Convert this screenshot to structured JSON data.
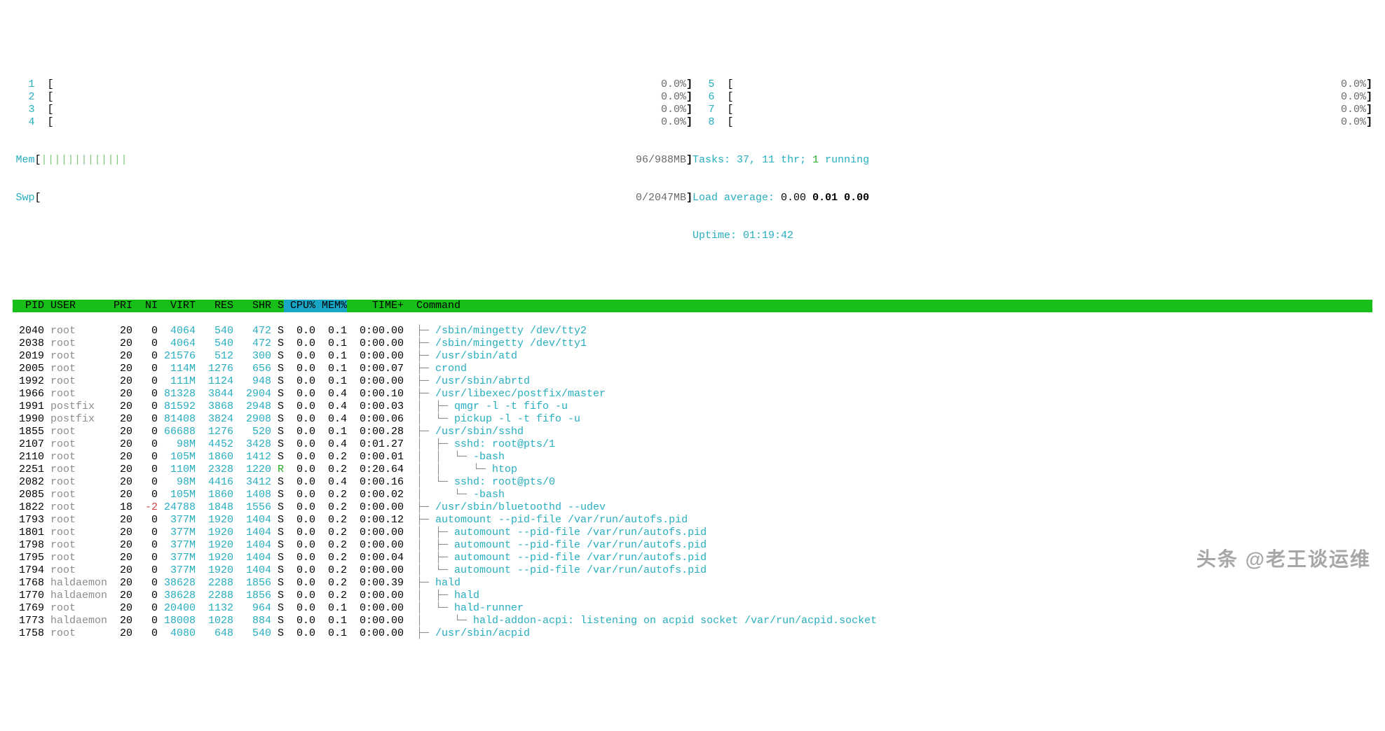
{
  "cpu_meters_left": [
    {
      "label": "1",
      "value": "0.0%"
    },
    {
      "label": "2",
      "value": "0.0%"
    },
    {
      "label": "3",
      "value": "0.0%"
    },
    {
      "label": "4",
      "value": "0.0%"
    }
  ],
  "cpu_meters_right": [
    {
      "label": "5",
      "value": "0.0%"
    },
    {
      "label": "6",
      "value": "0.0%"
    },
    {
      "label": "7",
      "value": "0.0%"
    },
    {
      "label": "8",
      "value": "0.0%"
    }
  ],
  "mem_meter": {
    "label": "Mem",
    "fill": "|||||||||||||",
    "value": "96/988MB"
  },
  "swp_meter": {
    "label": "Swp",
    "fill": "",
    "value": "0/2047MB"
  },
  "tasks": {
    "label": "Tasks:",
    "total": "37",
    "thr_label": "11 thr;",
    "running": "1",
    "running_label": "running"
  },
  "load": {
    "label": "Load average:",
    "v1": "0.00",
    "v2": "0.01",
    "v3": "0.00"
  },
  "uptime": {
    "label": "Uptime:",
    "value": "01:19:42"
  },
  "columns": [
    "PID",
    "USER",
    "PRI",
    "NI",
    "VIRT",
    "RES",
    "SHR",
    "S",
    "CPU%",
    "MEM%",
    "TIME+",
    "Command"
  ],
  "sort_columns": [
    "CPU%",
    "MEM%"
  ],
  "processes": [
    {
      "pid": "2040",
      "user": "root",
      "pri": "20",
      "ni": "0",
      "virt": "4064",
      "res": "540",
      "shr": "472",
      "s": "S",
      "cpu": "0.0",
      "mem": "0.1",
      "time": "0:00.00",
      "tree": "├─ ",
      "cmd": "/sbin/mingetty /dev/tty2"
    },
    {
      "pid": "2038",
      "user": "root",
      "pri": "20",
      "ni": "0",
      "virt": "4064",
      "res": "540",
      "shr": "472",
      "s": "S",
      "cpu": "0.0",
      "mem": "0.1",
      "time": "0:00.00",
      "tree": "├─ ",
      "cmd": "/sbin/mingetty /dev/tty1"
    },
    {
      "pid": "2019",
      "user": "root",
      "pri": "20",
      "ni": "0",
      "virt": "21576",
      "res": "512",
      "shr": "300",
      "s": "S",
      "cpu": "0.0",
      "mem": "0.1",
      "time": "0:00.00",
      "tree": "├─ ",
      "cmd": "/usr/sbin/atd"
    },
    {
      "pid": "2005",
      "user": "root",
      "pri": "20",
      "ni": "0",
      "virt": "114M",
      "res": "1276",
      "shr": "656",
      "s": "S",
      "cpu": "0.0",
      "mem": "0.1",
      "time": "0:00.07",
      "tree": "├─ ",
      "cmd": "crond"
    },
    {
      "pid": "1992",
      "user": "root",
      "pri": "20",
      "ni": "0",
      "virt": "111M",
      "res": "1124",
      "shr": "948",
      "s": "S",
      "cpu": "0.0",
      "mem": "0.1",
      "time": "0:00.00",
      "tree": "├─ ",
      "cmd": "/usr/sbin/abrtd"
    },
    {
      "pid": "1966",
      "user": "root",
      "pri": "20",
      "ni": "0",
      "virt": "81328",
      "res": "3844",
      "shr": "2904",
      "s": "S",
      "cpu": "0.0",
      "mem": "0.4",
      "time": "0:00.10",
      "tree": "├─ ",
      "cmd": "/usr/libexec/postfix/master"
    },
    {
      "pid": "1991",
      "user": "postfix",
      "pri": "20",
      "ni": "0",
      "virt": "81592",
      "res": "3868",
      "shr": "2948",
      "s": "S",
      "cpu": "0.0",
      "mem": "0.4",
      "time": "0:00.03",
      "tree": "│  ├─ ",
      "cmd": "qmgr -l -t fifo -u"
    },
    {
      "pid": "1990",
      "user": "postfix",
      "pri": "20",
      "ni": "0",
      "virt": "81408",
      "res": "3824",
      "shr": "2908",
      "s": "S",
      "cpu": "0.0",
      "mem": "0.4",
      "time": "0:00.06",
      "tree": "│  └─ ",
      "cmd": "pickup -l -t fifo -u"
    },
    {
      "pid": "1855",
      "user": "root",
      "pri": "20",
      "ni": "0",
      "virt": "66688",
      "res": "1276",
      "shr": "520",
      "s": "S",
      "cpu": "0.0",
      "mem": "0.1",
      "time": "0:00.28",
      "tree": "├─ ",
      "cmd": "/usr/sbin/sshd"
    },
    {
      "pid": "2107",
      "user": "root",
      "pri": "20",
      "ni": "0",
      "virt": "98M",
      "res": "4452",
      "shr": "3428",
      "s": "S",
      "cpu": "0.0",
      "mem": "0.4",
      "time": "0:01.27",
      "tree": "│  ├─ ",
      "cmd": "sshd: root@pts/1"
    },
    {
      "pid": "2110",
      "user": "root",
      "pri": "20",
      "ni": "0",
      "virt": "105M",
      "res": "1860",
      "shr": "1412",
      "s": "S",
      "cpu": "0.0",
      "mem": "0.2",
      "time": "0:00.01",
      "tree": "│  │  └─ ",
      "cmd": "-bash"
    },
    {
      "pid": "2251",
      "user": "root",
      "pri": "20",
      "ni": "0",
      "virt": "110M",
      "res": "2328",
      "shr": "1220",
      "s": "R",
      "cpu": "0.0",
      "mem": "0.2",
      "time": "0:20.64",
      "tree": "│  │     └─ ",
      "cmd": "htop"
    },
    {
      "pid": "2082",
      "user": "root",
      "pri": "20",
      "ni": "0",
      "virt": "98M",
      "res": "4416",
      "shr": "3412",
      "s": "S",
      "cpu": "0.0",
      "mem": "0.4",
      "time": "0:00.16",
      "tree": "│  └─ ",
      "cmd": "sshd: root@pts/0"
    },
    {
      "pid": "2085",
      "user": "root",
      "pri": "20",
      "ni": "0",
      "virt": "105M",
      "res": "1860",
      "shr": "1408",
      "s": "S",
      "cpu": "0.0",
      "mem": "0.2",
      "time": "0:00.02",
      "tree": "│     └─ ",
      "cmd": "-bash"
    },
    {
      "pid": "1822",
      "user": "root",
      "pri": "18",
      "ni": "-2",
      "virt": "24788",
      "res": "1848",
      "shr": "1556",
      "s": "S",
      "cpu": "0.0",
      "mem": "0.2",
      "time": "0:00.00",
      "tree": "├─ ",
      "cmd": "/usr/sbin/bluetoothd --udev"
    },
    {
      "pid": "1793",
      "user": "root",
      "pri": "20",
      "ni": "0",
      "virt": "377M",
      "res": "1920",
      "shr": "1404",
      "s": "S",
      "cpu": "0.0",
      "mem": "0.2",
      "time": "0:00.12",
      "tree": "├─ ",
      "cmd": "automount --pid-file /var/run/autofs.pid"
    },
    {
      "pid": "1801",
      "user": "root",
      "pri": "20",
      "ni": "0",
      "virt": "377M",
      "res": "1920",
      "shr": "1404",
      "s": "S",
      "cpu": "0.0",
      "mem": "0.2",
      "time": "0:00.00",
      "tree": "│  ├─ ",
      "cmd": "automount --pid-file /var/run/autofs.pid"
    },
    {
      "pid": "1798",
      "user": "root",
      "pri": "20",
      "ni": "0",
      "virt": "377M",
      "res": "1920",
      "shr": "1404",
      "s": "S",
      "cpu": "0.0",
      "mem": "0.2",
      "time": "0:00.00",
      "tree": "│  ├─ ",
      "cmd": "automount --pid-file /var/run/autofs.pid"
    },
    {
      "pid": "1795",
      "user": "root",
      "pri": "20",
      "ni": "0",
      "virt": "377M",
      "res": "1920",
      "shr": "1404",
      "s": "S",
      "cpu": "0.0",
      "mem": "0.2",
      "time": "0:00.04",
      "tree": "│  ├─ ",
      "cmd": "automount --pid-file /var/run/autofs.pid"
    },
    {
      "pid": "1794",
      "user": "root",
      "pri": "20",
      "ni": "0",
      "virt": "377M",
      "res": "1920",
      "shr": "1404",
      "s": "S",
      "cpu": "0.0",
      "mem": "0.2",
      "time": "0:00.00",
      "tree": "│  └─ ",
      "cmd": "automount --pid-file /var/run/autofs.pid"
    },
    {
      "pid": "1768",
      "user": "haldaemon",
      "pri": "20",
      "ni": "0",
      "virt": "38628",
      "res": "2288",
      "shr": "1856",
      "s": "S",
      "cpu": "0.0",
      "mem": "0.2",
      "time": "0:00.39",
      "tree": "├─ ",
      "cmd": "hald"
    },
    {
      "pid": "1770",
      "user": "haldaemon",
      "pri": "20",
      "ni": "0",
      "virt": "38628",
      "res": "2288",
      "shr": "1856",
      "s": "S",
      "cpu": "0.0",
      "mem": "0.2",
      "time": "0:00.00",
      "tree": "│  ├─ ",
      "cmd": "hald"
    },
    {
      "pid": "1769",
      "user": "root",
      "pri": "20",
      "ni": "0",
      "virt": "20400",
      "res": "1132",
      "shr": "964",
      "s": "S",
      "cpu": "0.0",
      "mem": "0.1",
      "time": "0:00.00",
      "tree": "│  └─ ",
      "cmd": "hald-runner"
    },
    {
      "pid": "1773",
      "user": "haldaemon",
      "pri": "20",
      "ni": "0",
      "virt": "18008",
      "res": "1028",
      "shr": "884",
      "s": "S",
      "cpu": "0.0",
      "mem": "0.1",
      "time": "0:00.00",
      "tree": "│     └─ ",
      "cmd": "hald-addon-acpi: listening on acpid socket /var/run/acpid.socket"
    },
    {
      "pid": "1758",
      "user": "root",
      "pri": "20",
      "ni": "0",
      "virt": "4080",
      "res": "648",
      "shr": "540",
      "s": "S",
      "cpu": "0.0",
      "mem": "0.1",
      "time": "0:00.00",
      "tree": "├─ ",
      "cmd": "/usr/sbin/acpid"
    }
  ],
  "watermark": "头条 @老王谈运维"
}
